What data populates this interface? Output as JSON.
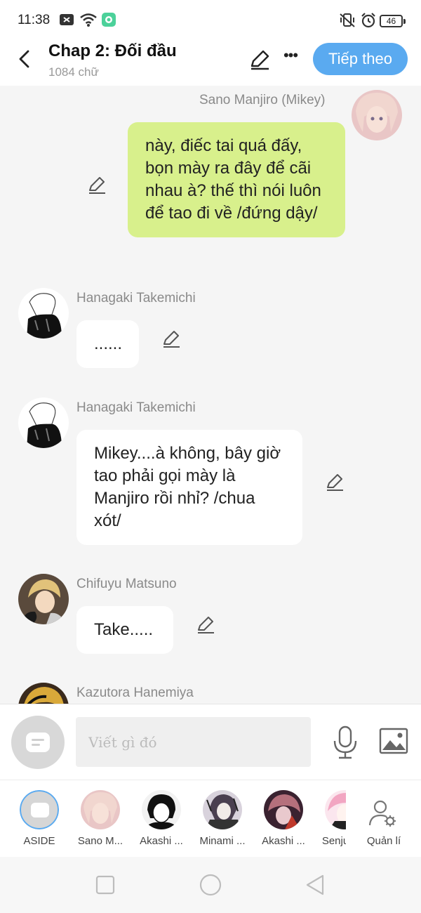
{
  "status_bar": {
    "time": "11:38",
    "battery": "46",
    "icons": [
      "notification-icon",
      "wifi-icon",
      "app-icon",
      "vibrate-icon",
      "alarm-icon"
    ]
  },
  "header": {
    "title": "Chap 2: Đối đầu",
    "word_count": "1084 chữ",
    "next_label": "Tiếp theo",
    "accent": "#5aaaf0"
  },
  "messages": [
    {
      "sender": "Sano Manjiro (Mikey)",
      "text": "này, điếc tai quá đấy, bọn mày ra đây để cãi nhau à? thế thì nói luôn để tao đi về /đứng dậy/",
      "mine": true
    },
    {
      "sender": "Hanagaki Takemichi",
      "text": "......",
      "mine": false
    },
    {
      "sender": "Hanagaki Takemichi",
      "text": "Mikey....à không, bây giờ tao phải gọi mày là Manjiro rồi nhỉ? /chua xót/",
      "mine": false
    },
    {
      "sender": "Chifuyu Matsuno",
      "text": "Take.....",
      "mine": false
    },
    {
      "sender": "Kazutora Hanemiya",
      "text": "",
      "mine": false
    }
  ],
  "composer": {
    "placeholder": "Viết gì đó",
    "bubble_color": "#d8f08c"
  },
  "characters": [
    {
      "label": "ASIDE"
    },
    {
      "label": "Sano M..."
    },
    {
      "label": "Akashi ..."
    },
    {
      "label": "Minami ..."
    },
    {
      "label": "Akashi ..."
    },
    {
      "label": "Senju"
    }
  ],
  "manage_label": "Quản lí"
}
